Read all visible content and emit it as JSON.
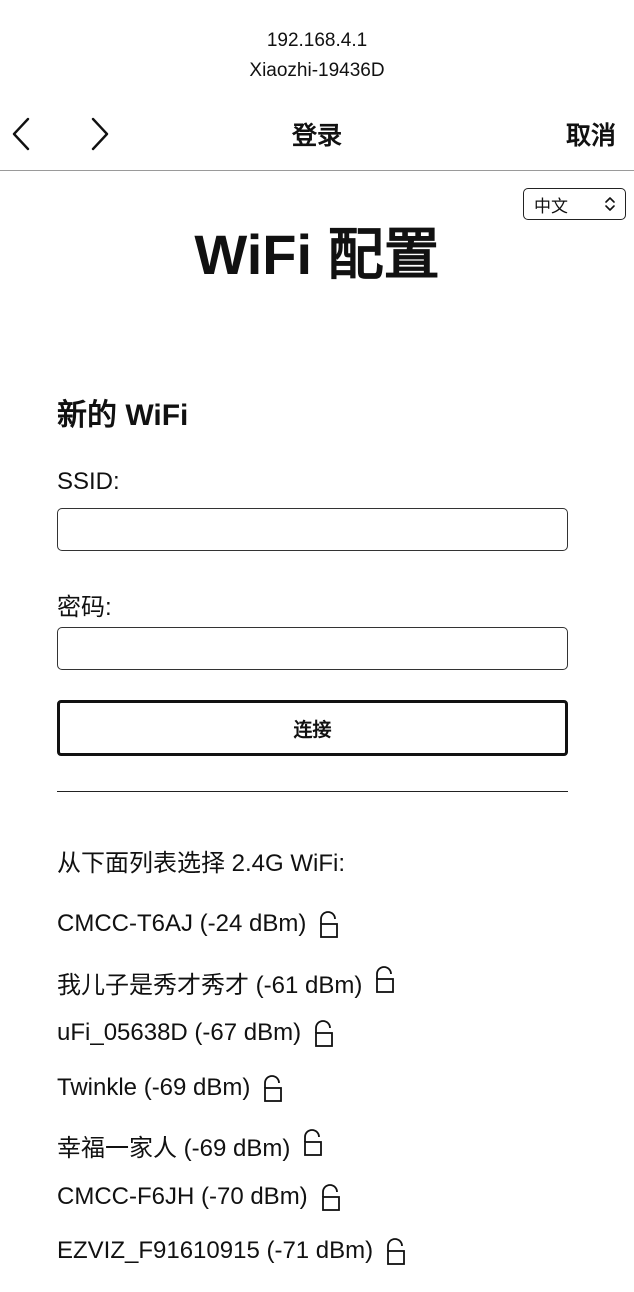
{
  "browser": {
    "host_ip": "192.168.4.1",
    "host_name": "Xiaozhi-19436D",
    "nav_title": "登录",
    "cancel_label": "取消",
    "back_icon": "chevron-left-icon",
    "forward_icon": "chevron-right-icon"
  },
  "page": {
    "language": "中文",
    "title": "WiFi 配置",
    "new_wifi_heading": "新的 WiFi",
    "ssid_label": "SSID:",
    "ssid_value": "",
    "password_label": "密码:",
    "password_value": "",
    "connect_label": "连接",
    "list_heading": "从下面列表选择 2.4G WiFi:"
  },
  "networks": [
    {
      "name": "CMCC-T6AJ (-24 dBm)",
      "icon": "lock-icon"
    },
    {
      "name": "我儿子是秀才秀才 (-61 dBm)",
      "icon": "lock-icon"
    },
    {
      "name": "uFi_05638D (-67 dBm)",
      "icon": "lock-icon"
    },
    {
      "name": "Twinkle (-69 dBm)",
      "icon": "lock-icon"
    },
    {
      "name": "幸福一家人 (-69 dBm)",
      "icon": "lock-icon"
    },
    {
      "name": "CMCC-F6JH (-70 dBm)",
      "icon": "lock-icon"
    },
    {
      "name": "EZVIZ_F91610915 (-71 dBm)",
      "icon": "lock-icon"
    }
  ]
}
